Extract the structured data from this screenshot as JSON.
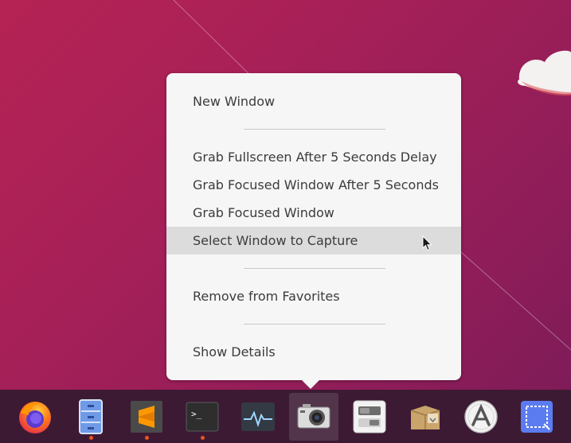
{
  "context_menu": {
    "items": [
      {
        "label": "New Window"
      },
      {
        "label": "Grab Fullscreen After 5 Seconds Delay"
      },
      {
        "label": "Grab Focused Window After 5 Seconds"
      },
      {
        "label": "Grab Focused Window"
      },
      {
        "label": "Select Window to Capture",
        "highlighted": true
      },
      {
        "label": "Remove from Favorites"
      },
      {
        "label": "Show Details"
      }
    ]
  },
  "dock": {
    "apps": [
      {
        "icon": "firefox-icon",
        "running": false
      },
      {
        "icon": "file-cabinet-icon",
        "running": true
      },
      {
        "icon": "sublime-text-icon",
        "running": true
      },
      {
        "icon": "terminal-icon",
        "running": true
      },
      {
        "icon": "system-monitor-icon",
        "running": false
      },
      {
        "icon": "camera-icon",
        "running": false,
        "active": true
      },
      {
        "icon": "tweaks-icon",
        "running": false
      },
      {
        "icon": "archive-box-icon",
        "running": false
      },
      {
        "icon": "app-store-icon",
        "running": false
      },
      {
        "icon": "screenshot-selection-icon",
        "running": false
      }
    ]
  },
  "colors": {
    "wallpaper": "#a72058",
    "dock_bg": "#3c1a33",
    "menu_bg": "#f6f6f6",
    "menu_hover": "#dcdcdc",
    "running_indicator": "#e95420"
  }
}
